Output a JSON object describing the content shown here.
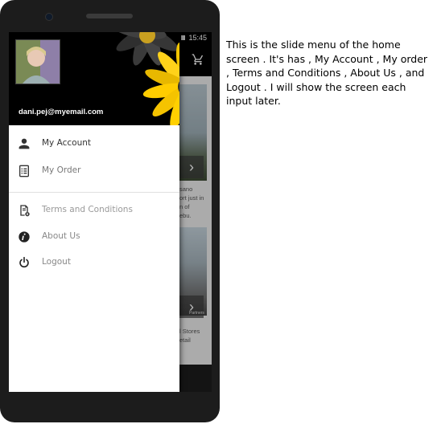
{
  "statusbar": {
    "time": "15:45"
  },
  "drawer": {
    "email": "dani.pej@myemail.com",
    "menu": [
      {
        "label": "My Account",
        "icon": "person-icon",
        "color": "#333333"
      },
      {
        "label": "My Order",
        "icon": "order-list-icon",
        "color": "#777777"
      },
      {
        "label": "Terms and Conditions",
        "icon": "document-icon",
        "color": "#999999"
      },
      {
        "label": "About Us",
        "icon": "info-icon",
        "color": "#888888"
      },
      {
        "label": "Logout",
        "icon": "power-icon",
        "color": "#888888"
      }
    ]
  },
  "home": {
    "text1": [
      "sano",
      "ort just in",
      "n of",
      "ebu."
    ],
    "text2": [
      "l Stores",
      "etail"
    ],
    "img_caption": "Partners"
  },
  "caption": "This is the slide menu of the home screen . It's has , My Account , My order , Terms and Conditions , About Us , and Logout . I will show the screen each input later."
}
